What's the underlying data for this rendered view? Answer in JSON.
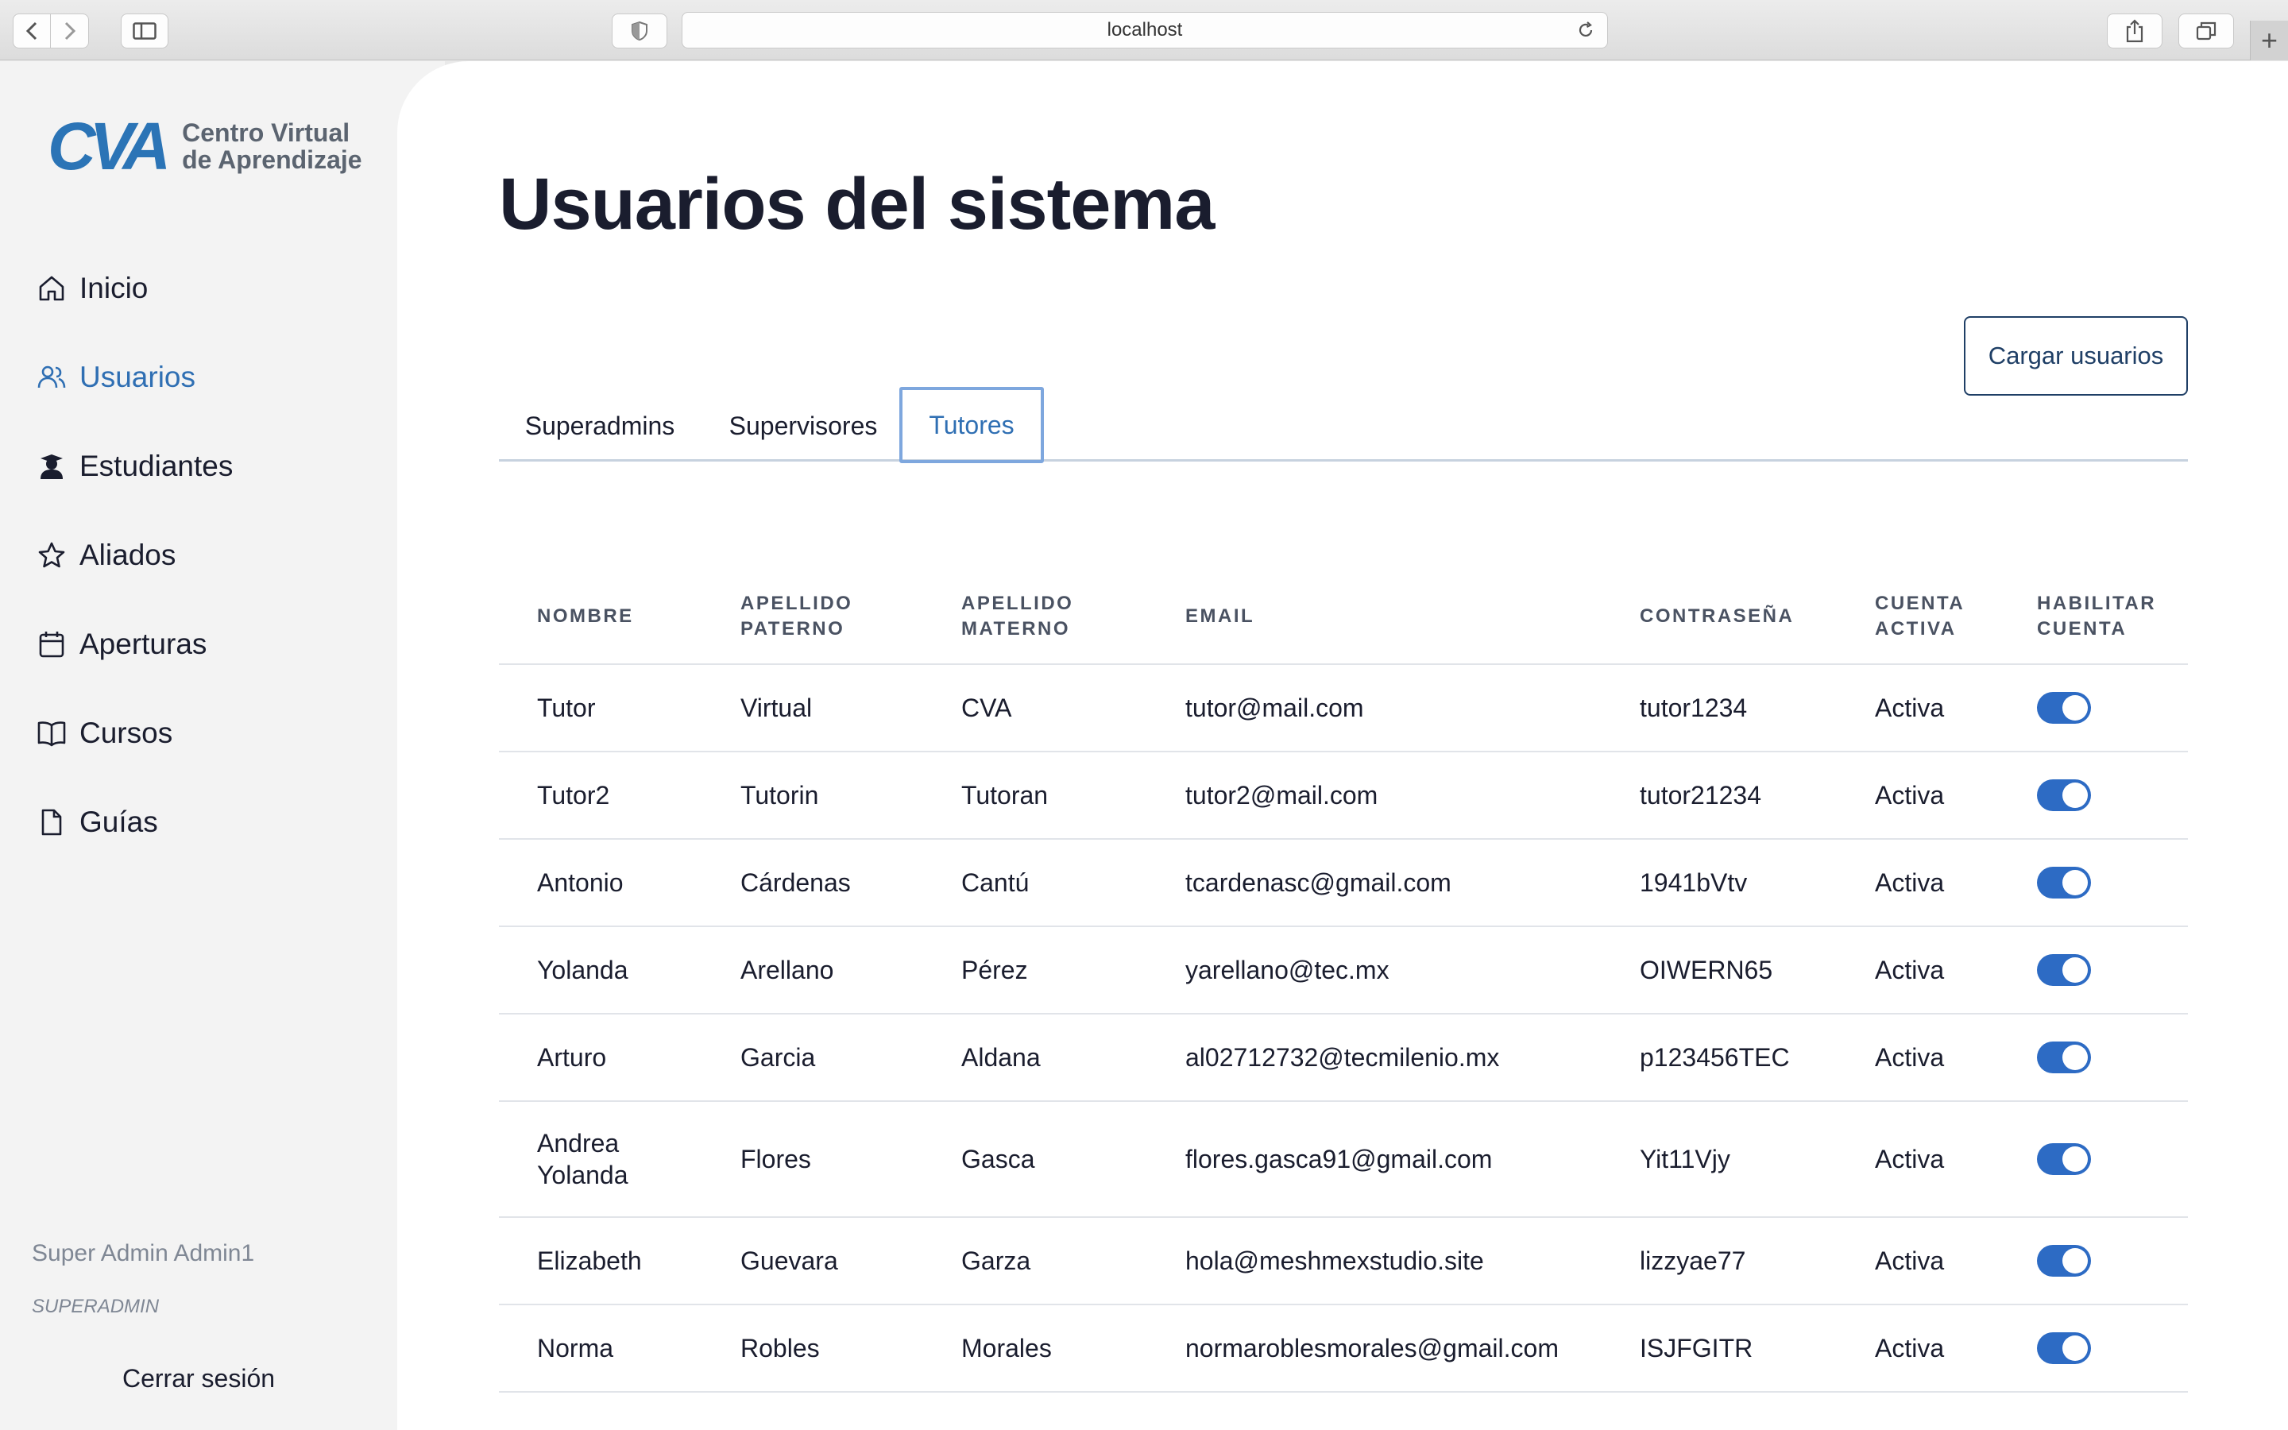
{
  "browser": {
    "url": "localhost"
  },
  "sidebar": {
    "logo_mark": "CVA",
    "logo_line1": "Centro Virtual",
    "logo_line2": "de Aprendizaje",
    "items": [
      {
        "label": "Inicio",
        "icon": "home-icon"
      },
      {
        "label": "Usuarios",
        "icon": "users-icon",
        "active": true
      },
      {
        "label": "Estudiantes",
        "icon": "student-icon"
      },
      {
        "label": "Aliados",
        "icon": "star-icon"
      },
      {
        "label": "Aperturas",
        "icon": "calendar-icon"
      },
      {
        "label": "Cursos",
        "icon": "book-icon"
      },
      {
        "label": "Guías",
        "icon": "document-icon"
      }
    ],
    "user_name": "Super Admin Admin1",
    "user_role": "SUPERADMIN",
    "logout_label": "Cerrar sesión"
  },
  "main": {
    "title": "Usuarios del sistema",
    "load_button": "Cargar usuarios",
    "tabs": [
      "Superadmins",
      "Supervisores",
      "Tutores"
    ],
    "active_tab": "Tutores"
  },
  "table": {
    "headers": [
      [
        "NOMBRE"
      ],
      [
        "APELLIDO",
        "PATERNO"
      ],
      [
        "APELLIDO",
        "MATERNO"
      ],
      [
        "EMAIL"
      ],
      [
        "CONTRASEÑA"
      ],
      [
        "CUENTA",
        "ACTIVA"
      ],
      [
        "HABILITAR",
        "CUENTA"
      ]
    ],
    "rows": [
      {
        "nombre": "Tutor",
        "paterno": "Virtual",
        "materno": "CVA",
        "email": "tutor@mail.com",
        "password": "tutor1234",
        "estado": "Activa",
        "enabled": true
      },
      {
        "nombre": "Tutor2",
        "paterno": "Tutorin",
        "materno": "Tutoran",
        "email": "tutor2@mail.com",
        "password": "tutor21234",
        "estado": "Activa",
        "enabled": true
      },
      {
        "nombre": "Antonio",
        "paterno": "Cárdenas",
        "materno": "Cantú",
        "email": "tcardenasc@gmail.com",
        "password": "1941bVtv",
        "estado": "Activa",
        "enabled": true
      },
      {
        "nombre": "Yolanda",
        "paterno": "Arellano",
        "materno": "Pérez",
        "email": "yarellano@tec.mx",
        "password": "OIWERN65",
        "estado": "Activa",
        "enabled": true
      },
      {
        "nombre": "Arturo",
        "paterno": "Garcia",
        "materno": "Aldana",
        "email": "al02712732@tecmilenio.mx",
        "password": "p123456TEC",
        "estado": "Activa",
        "enabled": true
      },
      {
        "nombre": "Andrea Yolanda",
        "paterno": "Flores",
        "materno": "Gasca",
        "email": "flores.gasca91@gmail.com",
        "password": "Yit11Vjy",
        "estado": "Activa",
        "enabled": true
      },
      {
        "nombre": "Elizabeth",
        "paterno": "Guevara",
        "materno": "Garza",
        "email": "hola@meshmexstudio.site",
        "password": "lizzyae77",
        "estado": "Activa",
        "enabled": true
      },
      {
        "nombre": "Norma",
        "paterno": "Robles",
        "materno": "Morales",
        "email": "normaroblesmorales@gmail.com",
        "password": "ISJFGITR",
        "estado": "Activa",
        "enabled": true
      }
    ]
  },
  "colors": {
    "accent": "#2f6fb3",
    "toggle_on": "#2d6bc4",
    "text": "#1a1d2e"
  }
}
